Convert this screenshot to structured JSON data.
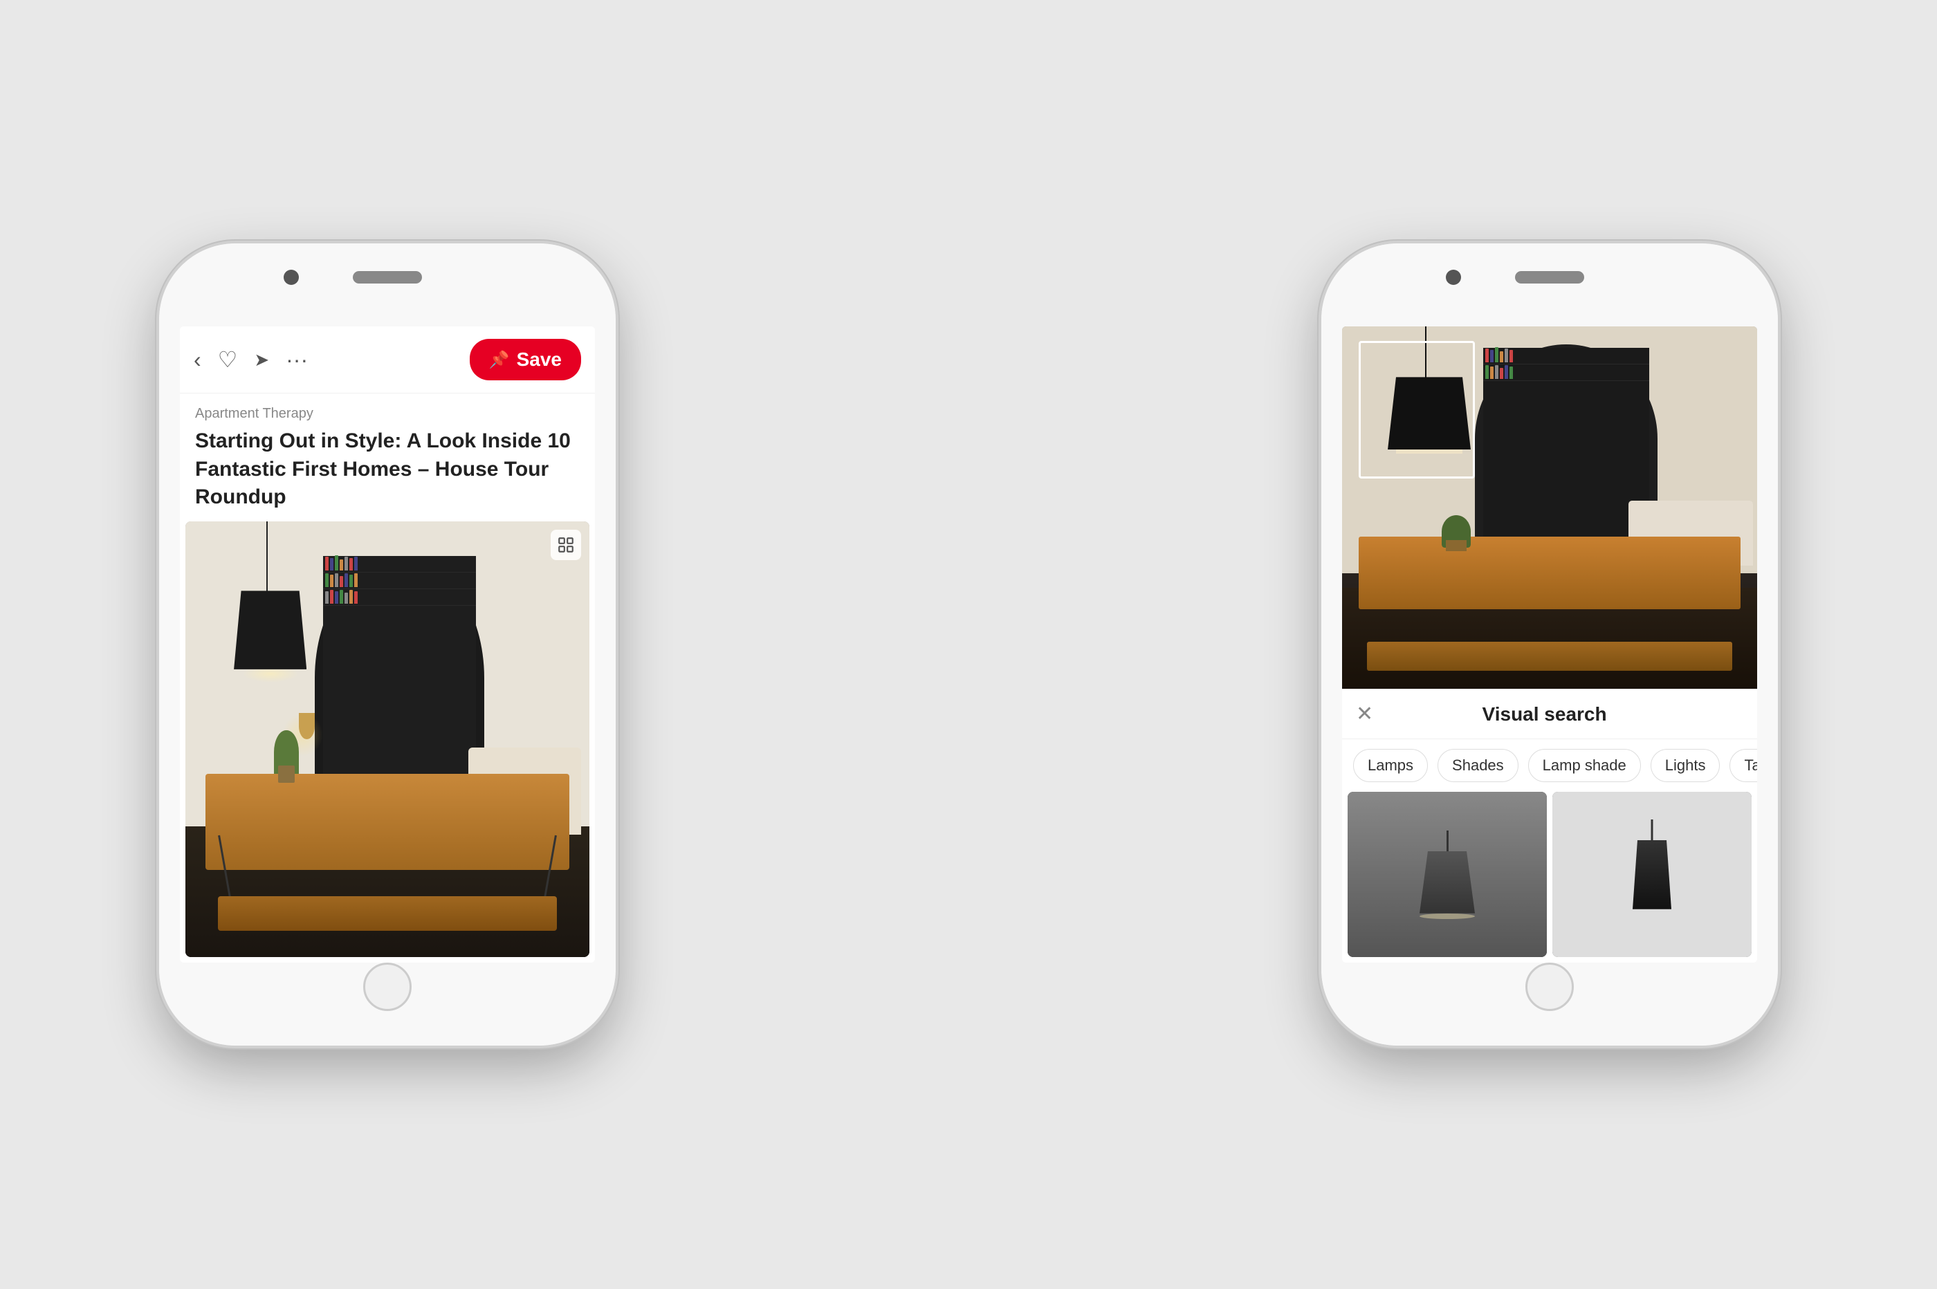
{
  "page": {
    "background_color": "#e8e8e8"
  },
  "left_phone": {
    "top_bar": {
      "back_label": "‹",
      "heart_label": "♡",
      "send_label": "➤",
      "more_label": "···",
      "save_label": "Save"
    },
    "article": {
      "source": "Apartment Therapy",
      "title": "Starting Out in Style: A Look Inside 10 Fantastic First Homes – House Tour Roundup"
    },
    "image_alt": "Interior dining room with pendant lamp, bookshelf, wooden table"
  },
  "right_phone": {
    "visual_search": {
      "close_label": "✕",
      "title": "Visual search",
      "tags": [
        "Lamps",
        "Shades",
        "Lamp shade",
        "Lights",
        "Tab"
      ],
      "results": [
        {
          "alt": "Dark pendant lamp result 1"
        },
        {
          "alt": "Dark pendant lamp result 2"
        }
      ]
    }
  }
}
